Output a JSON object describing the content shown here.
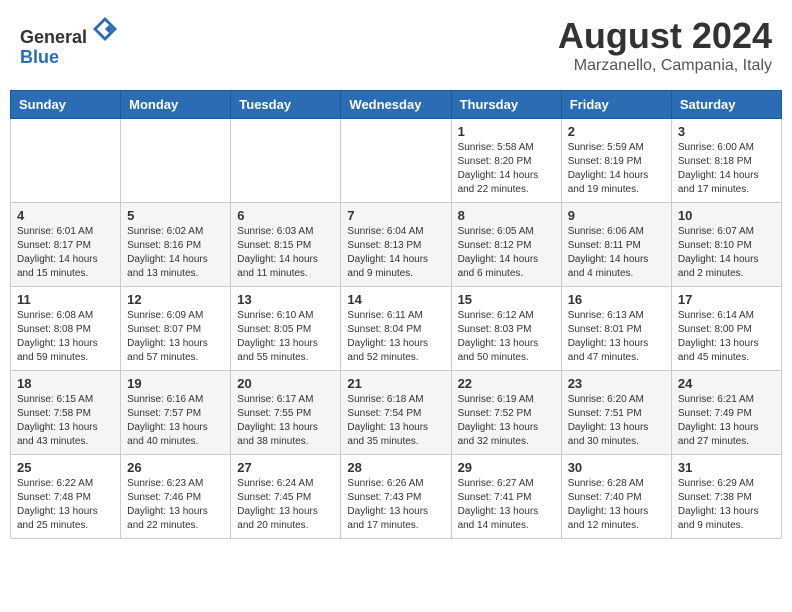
{
  "header": {
    "logo_line1": "General",
    "logo_line2": "Blue",
    "month_year": "August 2024",
    "location": "Marzanello, Campania, Italy"
  },
  "days_of_week": [
    "Sunday",
    "Monday",
    "Tuesday",
    "Wednesday",
    "Thursday",
    "Friday",
    "Saturday"
  ],
  "weeks": [
    [
      {
        "day": "",
        "info": ""
      },
      {
        "day": "",
        "info": ""
      },
      {
        "day": "",
        "info": ""
      },
      {
        "day": "",
        "info": ""
      },
      {
        "day": "1",
        "info": "Sunrise: 5:58 AM\nSunset: 8:20 PM\nDaylight: 14 hours\nand 22 minutes."
      },
      {
        "day": "2",
        "info": "Sunrise: 5:59 AM\nSunset: 8:19 PM\nDaylight: 14 hours\nand 19 minutes."
      },
      {
        "day": "3",
        "info": "Sunrise: 6:00 AM\nSunset: 8:18 PM\nDaylight: 14 hours\nand 17 minutes."
      }
    ],
    [
      {
        "day": "4",
        "info": "Sunrise: 6:01 AM\nSunset: 8:17 PM\nDaylight: 14 hours\nand 15 minutes."
      },
      {
        "day": "5",
        "info": "Sunrise: 6:02 AM\nSunset: 8:16 PM\nDaylight: 14 hours\nand 13 minutes."
      },
      {
        "day": "6",
        "info": "Sunrise: 6:03 AM\nSunset: 8:15 PM\nDaylight: 14 hours\nand 11 minutes."
      },
      {
        "day": "7",
        "info": "Sunrise: 6:04 AM\nSunset: 8:13 PM\nDaylight: 14 hours\nand 9 minutes."
      },
      {
        "day": "8",
        "info": "Sunrise: 6:05 AM\nSunset: 8:12 PM\nDaylight: 14 hours\nand 6 minutes."
      },
      {
        "day": "9",
        "info": "Sunrise: 6:06 AM\nSunset: 8:11 PM\nDaylight: 14 hours\nand 4 minutes."
      },
      {
        "day": "10",
        "info": "Sunrise: 6:07 AM\nSunset: 8:10 PM\nDaylight: 14 hours\nand 2 minutes."
      }
    ],
    [
      {
        "day": "11",
        "info": "Sunrise: 6:08 AM\nSunset: 8:08 PM\nDaylight: 13 hours\nand 59 minutes."
      },
      {
        "day": "12",
        "info": "Sunrise: 6:09 AM\nSunset: 8:07 PM\nDaylight: 13 hours\nand 57 minutes."
      },
      {
        "day": "13",
        "info": "Sunrise: 6:10 AM\nSunset: 8:05 PM\nDaylight: 13 hours\nand 55 minutes."
      },
      {
        "day": "14",
        "info": "Sunrise: 6:11 AM\nSunset: 8:04 PM\nDaylight: 13 hours\nand 52 minutes."
      },
      {
        "day": "15",
        "info": "Sunrise: 6:12 AM\nSunset: 8:03 PM\nDaylight: 13 hours\nand 50 minutes."
      },
      {
        "day": "16",
        "info": "Sunrise: 6:13 AM\nSunset: 8:01 PM\nDaylight: 13 hours\nand 47 minutes."
      },
      {
        "day": "17",
        "info": "Sunrise: 6:14 AM\nSunset: 8:00 PM\nDaylight: 13 hours\nand 45 minutes."
      }
    ],
    [
      {
        "day": "18",
        "info": "Sunrise: 6:15 AM\nSunset: 7:58 PM\nDaylight: 13 hours\nand 43 minutes."
      },
      {
        "day": "19",
        "info": "Sunrise: 6:16 AM\nSunset: 7:57 PM\nDaylight: 13 hours\nand 40 minutes."
      },
      {
        "day": "20",
        "info": "Sunrise: 6:17 AM\nSunset: 7:55 PM\nDaylight: 13 hours\nand 38 minutes."
      },
      {
        "day": "21",
        "info": "Sunrise: 6:18 AM\nSunset: 7:54 PM\nDaylight: 13 hours\nand 35 minutes."
      },
      {
        "day": "22",
        "info": "Sunrise: 6:19 AM\nSunset: 7:52 PM\nDaylight: 13 hours\nand 32 minutes."
      },
      {
        "day": "23",
        "info": "Sunrise: 6:20 AM\nSunset: 7:51 PM\nDaylight: 13 hours\nand 30 minutes."
      },
      {
        "day": "24",
        "info": "Sunrise: 6:21 AM\nSunset: 7:49 PM\nDaylight: 13 hours\nand 27 minutes."
      }
    ],
    [
      {
        "day": "25",
        "info": "Sunrise: 6:22 AM\nSunset: 7:48 PM\nDaylight: 13 hours\nand 25 minutes."
      },
      {
        "day": "26",
        "info": "Sunrise: 6:23 AM\nSunset: 7:46 PM\nDaylight: 13 hours\nand 22 minutes."
      },
      {
        "day": "27",
        "info": "Sunrise: 6:24 AM\nSunset: 7:45 PM\nDaylight: 13 hours\nand 20 minutes."
      },
      {
        "day": "28",
        "info": "Sunrise: 6:26 AM\nSunset: 7:43 PM\nDaylight: 13 hours\nand 17 minutes."
      },
      {
        "day": "29",
        "info": "Sunrise: 6:27 AM\nSunset: 7:41 PM\nDaylight: 13 hours\nand 14 minutes."
      },
      {
        "day": "30",
        "info": "Sunrise: 6:28 AM\nSunset: 7:40 PM\nDaylight: 13 hours\nand 12 minutes."
      },
      {
        "day": "31",
        "info": "Sunrise: 6:29 AM\nSunset: 7:38 PM\nDaylight: 13 hours\nand 9 minutes."
      }
    ]
  ]
}
